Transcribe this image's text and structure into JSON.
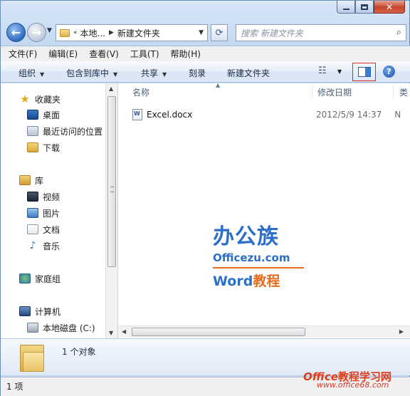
{
  "address": {
    "crumbs": [
      "«",
      "本地...",
      "新建文件夹"
    ]
  },
  "search": {
    "placeholder": "搜索 新建文件夹"
  },
  "menu": [
    "文件(F)",
    "编辑(E)",
    "查看(V)",
    "工具(T)",
    "帮助(H)"
  ],
  "commands": {
    "organize": "组织",
    "include_library": "包含到库中",
    "share": "共享",
    "burn": "刻录",
    "new_folder": "新建文件夹"
  },
  "nav": {
    "favorites": "收藏夹",
    "desktop": "桌面",
    "recent": "最近访问的位置",
    "downloads": "下载",
    "libraries": "库",
    "videos": "视频",
    "pictures": "图片",
    "documents": "文档",
    "music": "音乐",
    "homegroup": "家庭组",
    "computer": "计算机",
    "local_disk": "本地磁盘 (C:)"
  },
  "columns": {
    "name": "名称",
    "date": "修改日期",
    "extra": "类"
  },
  "files": [
    {
      "name": "Excel.docx",
      "date": "2012/5/9 14:37",
      "type_initial": "N"
    }
  ],
  "watermark": {
    "line1": "办公族",
    "line2": "Officezu.com",
    "line3_a": "Word",
    "line3_b": "教程"
  },
  "details": {
    "count": "1 个对象"
  },
  "logo2": {
    "a": "Office",
    "b": "教程学习网",
    "url": "www.office68.com"
  },
  "status": {
    "items": "1 项"
  }
}
